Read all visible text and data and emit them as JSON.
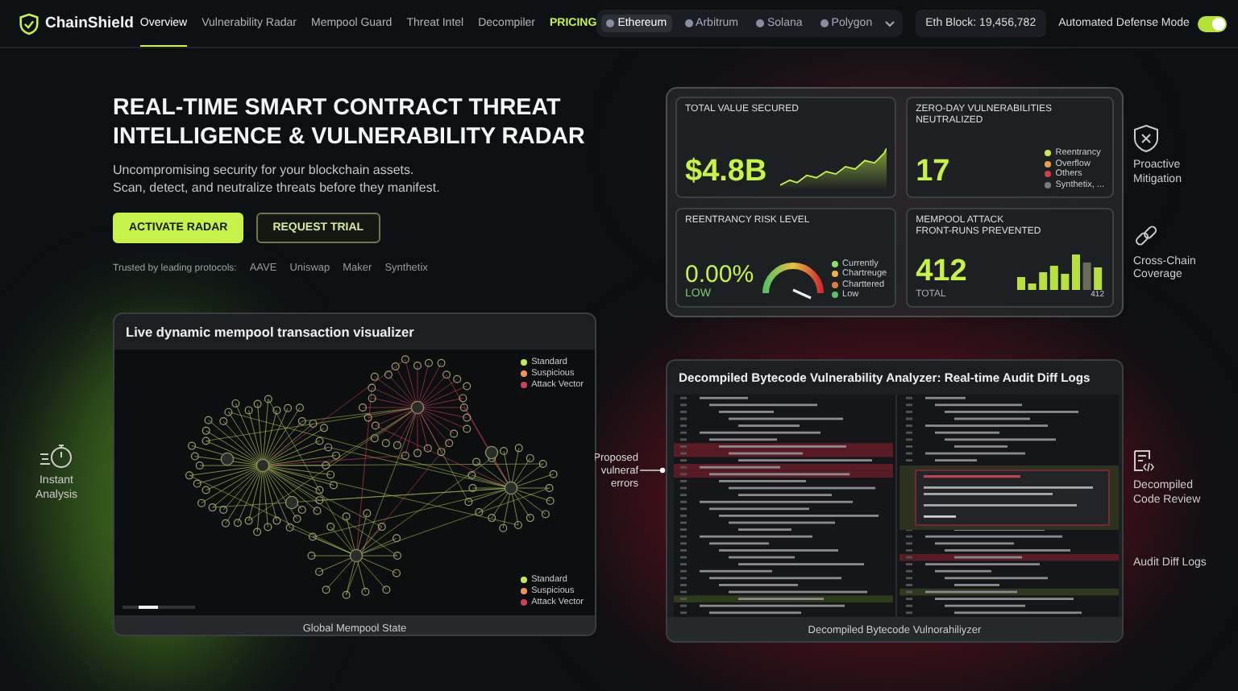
{
  "nav": {
    "brand": "ChainShield",
    "links": [
      {
        "label": "Overview",
        "selected": true,
        "kind": "link"
      },
      {
        "label": "Vulnerability Radar",
        "selected": false,
        "kind": "link"
      },
      {
        "label": "Mempool Guard",
        "selected": false,
        "kind": "link"
      },
      {
        "label": "Threat Intel",
        "selected": false,
        "kind": "link"
      },
      {
        "label": "Decompiler",
        "selected": false,
        "kind": "link"
      },
      {
        "label": "PRICING",
        "selected": false,
        "kind": "highlight"
      }
    ],
    "chains": [
      {
        "label": "Ethereum",
        "selected": true
      },
      {
        "label": "Arbitrum",
        "selected": false
      },
      {
        "label": "Solana",
        "selected": false
      },
      {
        "label": "Polygon",
        "selected": false
      }
    ],
    "block": "Eth Block: 19,456,782",
    "toggle": {
      "label": "Automated Defense Mode",
      "on": true
    }
  },
  "hero": {
    "title": [
      "REAL-TIME SMART CONTRACT THREAT",
      "INTELLIGENCE & VULNERABILITY RADAR"
    ],
    "subtitle": [
      "Uncompromising security for your blockchain assets.",
      "Scan, detect, and neutralize threats before they manifest."
    ],
    "buttons": [
      {
        "label": "ACTIVATE RADAR",
        "kind": "primary"
      },
      {
        "label": "REQUEST TRIAL",
        "kind": "secondary"
      }
    ],
    "trusted": "Trusted by leading protocols:",
    "protocols": [
      "AAVE",
      "Uniswap",
      "Maker",
      "Synthetix"
    ]
  },
  "stats": {
    "tvs": {
      "title": "TOTAL VALUE SECURED",
      "value": "$4.8B"
    },
    "zero_day": {
      "title": "ZERO-DAY VULNERABILITIES NEUTRALIZED",
      "value": "17",
      "legend": [
        {
          "label": "Reentrancy",
          "color": "#c8e85a"
        },
        {
          "label": "Overflow",
          "color": "#e8a04a"
        },
        {
          "label": "Others",
          "color": "#d0404a"
        },
        {
          "label": "Synthetix, ...",
          "color": "#7a7a7a"
        }
      ]
    },
    "risk": {
      "title": "REENTRANCY RISK LEVEL",
      "value": "0.00%",
      "rating": "LOW",
      "legend": [
        {
          "label": "Currently",
          "color": "#8ee06a"
        },
        {
          "label": "Chartreuge",
          "color": "#e8b04a"
        },
        {
          "label": "Charttered",
          "color": "#e07a3a"
        },
        {
          "label": "Low",
          "color": "#5cc06a"
        }
      ]
    },
    "mempool": {
      "title": [
        "MEMPOOL ATTACK",
        "FRONT-RUNS PREVENTED"
      ],
      "value": "412",
      "caption": "TOTAL",
      "chart_label": "412"
    }
  },
  "features_left": [
    {
      "label": "Instant Analysis"
    }
  ],
  "features_right": [
    {
      "label": "Proactive Mitigation"
    },
    {
      "label": "Cross-Chain Coverage"
    },
    {
      "label": "Decompiled Code Review"
    },
    {
      "label": "Audit Diff Logs"
    }
  ],
  "callout": "Proposed vulneraf errors",
  "mempool_panel": {
    "title": "Live dynamic mempool transaction visualizer",
    "legend_top": [
      {
        "label": "Standard",
        "color": "#c8e85a"
      },
      {
        "label": "Suspicious",
        "color": "#e8965a"
      },
      {
        "label": "Attack Vector",
        "color": "#d0405a"
      }
    ],
    "legend_bottom": [
      {
        "label": "Standard",
        "color": "#c8e85a"
      },
      {
        "label": "Suspicious",
        "color": "#e8965a"
      },
      {
        "label": "Attack Vector",
        "color": "#d0405a"
      }
    ],
    "footer": "Global Mempool State"
  },
  "code_panel": {
    "title": "Decompiled Bytecode Vulnerability Analyzer: Real-time Audit Diff Logs",
    "footer": "Decompiled Bytecode Vulnorahiliyzer"
  }
}
